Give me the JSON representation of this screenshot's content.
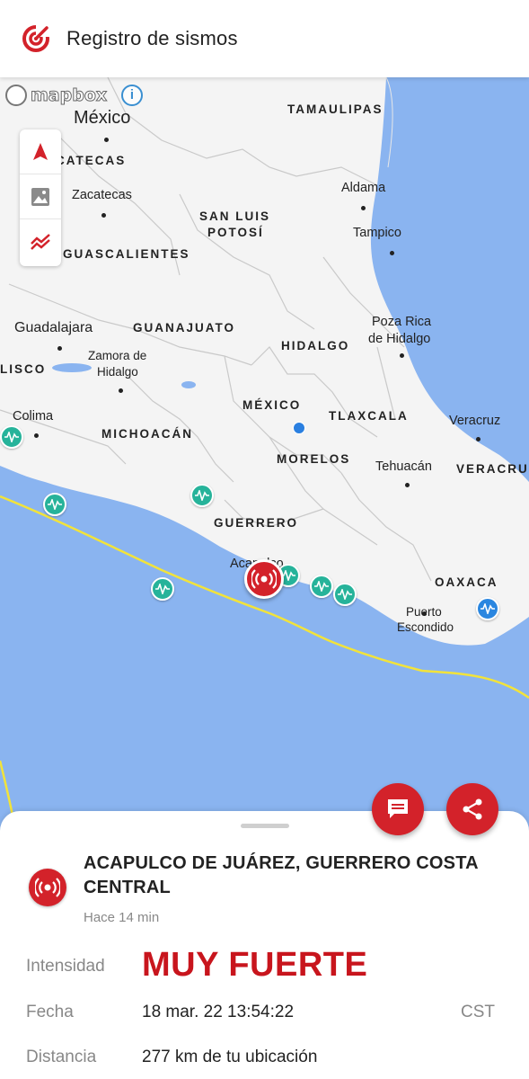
{
  "app": {
    "title": "Registro de sismos"
  },
  "map": {
    "attribution": "mapbox",
    "state_labels": [
      "TAMAULIPAS",
      "CATECAS",
      "SAN LUIS",
      "POTOSÍ",
      "GUASCALIENTES",
      "GUANAJUATO",
      "HIDALGO",
      "LISCO",
      "MÉXICO",
      "TLAXCALA",
      "MICHOACÁN",
      "MORELOS",
      "VERACRU",
      "GUERRERO",
      "OAXACA"
    ],
    "city_labels": [
      "México",
      "Zacatecas",
      "Aldama",
      "Tampico",
      "Guadalajara",
      "Poza Rica",
      "de Hidalgo",
      "Zamora de",
      "Hidalgo",
      "Colima",
      "Veracruz",
      "Tehuacán",
      "Acapulco",
      "Puerto",
      "Escondido"
    ],
    "controls": [
      "compass-icon",
      "image-layers-icon",
      "faults-icon"
    ]
  },
  "detail": {
    "place": "ACAPULCO DE JUÁREZ, GUERRERO COSTA CENTRAL",
    "ago": "Hace 14 min",
    "intensity_label": "Intensidad",
    "intensity_value": "MUY FUERTE",
    "date_label": "Fecha",
    "date_value": "18 mar. 22 13:54:22",
    "timezone": "CST",
    "distance_label": "Distancia",
    "distance_value": "277 km de tu ubicación"
  },
  "colors": {
    "accent": "#d3222a",
    "quake_green": "#26b39a",
    "quake_blue": "#2a86e0",
    "sea": "#8ab4f0",
    "fault": "#f2e33a"
  }
}
